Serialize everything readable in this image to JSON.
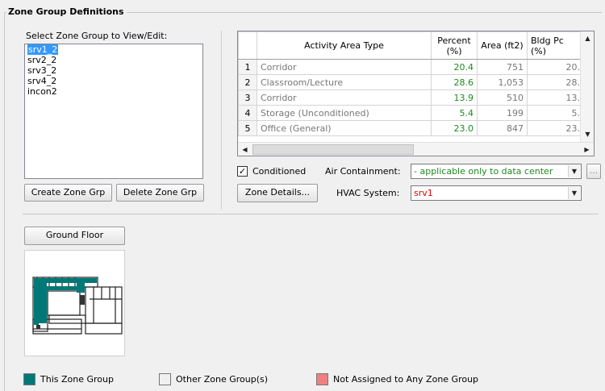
{
  "group": {
    "title": "Zone Group Definitions"
  },
  "list": {
    "label": "Select Zone Group to View/Edit:",
    "items": [
      "srv1_2",
      "srv2_2",
      "srv3_2",
      "srv4_2",
      "incon2"
    ],
    "selected_index": 0
  },
  "buttons": {
    "create": "Create Zone Grp",
    "delete": "Delete Zone Grp",
    "zone_details": "Zone Details...",
    "ellipsis": "...",
    "ground_floor": "Ground Floor"
  },
  "grid": {
    "headers": [
      "Activity Area Type",
      "Percent\n(%)",
      "Area (ft2)",
      "Bldg Pc\n(%)"
    ],
    "header_line1": {
      "type": "Activity Area Type",
      "pct": "Percent",
      "area": "Area (ft2)",
      "bldg": "Bldg Pc"
    },
    "header_line2": {
      "pct": "(%)",
      "bldg": "(%)"
    },
    "rows": [
      {
        "num": "1",
        "type": "Corridor",
        "pct": "20.4",
        "area": "751",
        "bldg": "20."
      },
      {
        "num": "2",
        "type": "Classroom/Lecture",
        "pct": "28.6",
        "area": "1,053",
        "bldg": "28."
      },
      {
        "num": "3",
        "type": "Corridor",
        "pct": "13.9",
        "area": "510",
        "bldg": "13."
      },
      {
        "num": "4",
        "type": "Storage (Unconditioned)",
        "pct": "5.4",
        "area": "199",
        "bldg": "5."
      },
      {
        "num": "5",
        "type": "Office (General)",
        "pct": "23.0",
        "area": "847",
        "bldg": "23."
      }
    ]
  },
  "conditioned": {
    "label": "Conditioned",
    "checked": true
  },
  "air_containment": {
    "label": "Air Containment:",
    "value": "- applicable only to data center",
    "value_color": "#1e8a1e"
  },
  "hvac": {
    "label": "HVAC System:",
    "value": "srv1",
    "value_color": "#e00000"
  },
  "legend": {
    "this_group": {
      "label": "This Zone Group",
      "color": "#007878"
    },
    "other_group": {
      "label": "Other Zone Group(s)",
      "color": "#f0f0f0"
    },
    "not_assigned": {
      "label": "Not Assigned to Any Zone Group",
      "color": "#f08080"
    }
  },
  "icons": {
    "scroll_up": "triangle-up-icon",
    "scroll_down": "triangle-down-icon",
    "scroll_left": "triangle-left-icon",
    "scroll_right": "triangle-right-icon",
    "dropdown": "triangle-down-icon"
  }
}
